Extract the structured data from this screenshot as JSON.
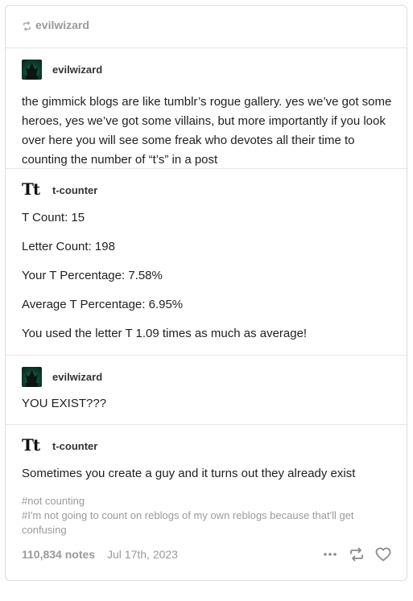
{
  "reblog_header": {
    "username": "evilwizard"
  },
  "posts": [
    {
      "username": "evilwizard",
      "avatar": "wizard-avatar",
      "text": "the gimmick blogs are like tumblr’s rogue gallery. yes we’ve got some heroes, yes we’ve got some villains, but more importantly if you look over here you will see some freak who devotes all their time to counting the number of “t’s” in a post"
    },
    {
      "username": "t-counter",
      "avatar_text": "Tt",
      "lines": [
        "T Count: 15",
        "Letter Count: 198",
        "Your T Percentage: 7.58%",
        "Average T Percentage: 6.95%",
        "You used the letter T 1.09 times as much as average!"
      ]
    },
    {
      "username": "evilwizard",
      "avatar": "wizard-avatar",
      "text": "YOU EXIST???"
    },
    {
      "username": "t-counter",
      "avatar_text": "Tt",
      "text": "Sometimes you create a guy and it turns out they already exist"
    }
  ],
  "tags": [
    "#not counting",
    "#I'm not going to count on reblogs of my own reblogs because that'll get confusing"
  ],
  "footer": {
    "notes": "110,834 notes",
    "date": "Jul 17th, 2023",
    "icons": [
      "more-dots-icon",
      "reblog-icon",
      "heart-icon"
    ]
  }
}
